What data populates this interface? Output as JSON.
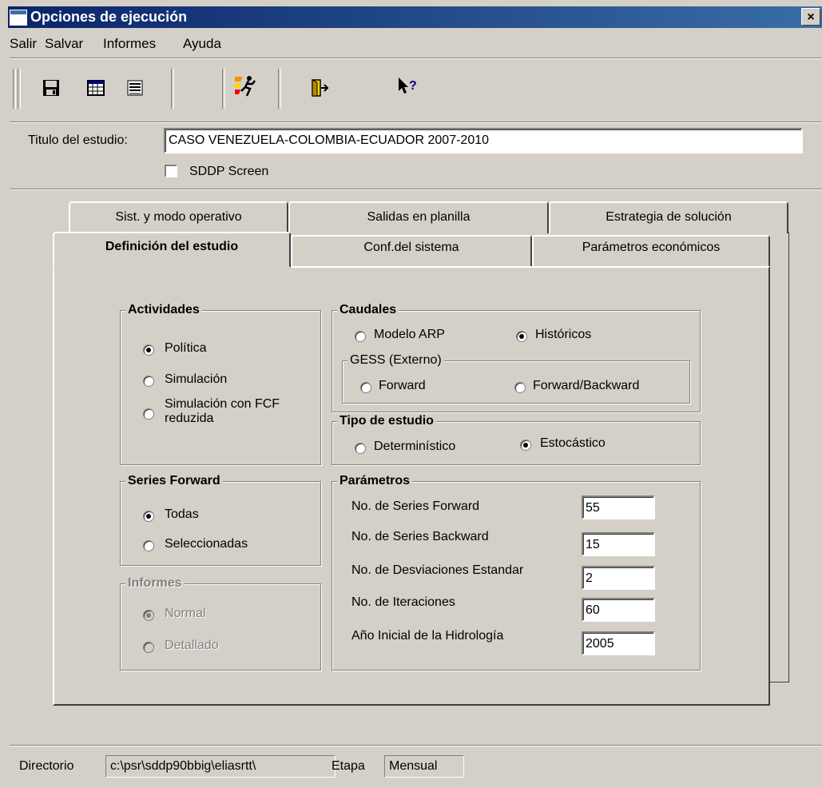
{
  "window": {
    "title": "Opciones de ejecución",
    "close": "×"
  },
  "menu": [
    "Salir",
    "Salvar",
    "Informes",
    "Ayuda"
  ],
  "toolbar": {
    "icons": [
      "save-icon",
      "table-icon",
      "list-icon",
      "run-icon",
      "exit-icon",
      "help-pointer-icon"
    ]
  },
  "study": {
    "title_label": "Titulo del estudio:",
    "title_value": "CASO VENEZUELA-COLOMBIA-ECUADOR 2007-2010",
    "sddp_screen_label": "SDDP Screen",
    "sddp_screen_checked": false
  },
  "tabs": {
    "row1": [
      "Sist. y modo operativo",
      "Salidas en planilla",
      "Estrategia de solución"
    ],
    "row2": [
      "Definición del estudio",
      "Conf.del sistema",
      "Parámetros económicos"
    ],
    "active": "Definición del estudio"
  },
  "actividades": {
    "title": "Actividades",
    "options": [
      "Política",
      "Simulación",
      "Simulación con FCF",
      "reduzida"
    ],
    "selected": "Política"
  },
  "caudales": {
    "title": "Caudales",
    "modelo": "Modelo ARP",
    "historicos": "Históricos",
    "selected": "Históricos",
    "gess_title": "GESS (Externo)",
    "forward": "Forward",
    "forward_backward": "Forward/Backward"
  },
  "tipo": {
    "title": "Tipo de estudio",
    "deterministico": "Determinístico",
    "estocastico": "Estocástico",
    "selected": "Estocástico"
  },
  "series": {
    "title": "Series Forward",
    "todas": "Todas",
    "seleccionadas": "Seleccionadas",
    "selected": "Todas"
  },
  "parametros": {
    "title": "Parámetros",
    "rows": [
      {
        "label": "No. de Series Forward",
        "value": "55"
      },
      {
        "label": "No. de Series Backward",
        "value": "15"
      },
      {
        "label": "No. de Desviaciones Estandar",
        "value": "2"
      },
      {
        "label": "No. de Iteraciones",
        "value": "60"
      },
      {
        "label": "Año Inicial de la Hidrología",
        "value": "2005"
      }
    ]
  },
  "informes": {
    "title": "Informes",
    "normal": "Normal",
    "detallado": "Detallado",
    "selected": "Normal",
    "disabled": true
  },
  "status": {
    "dir_label": "Directorio",
    "dir_value": "c:\\psr\\sddp90bbig\\eliasrtt\\",
    "etapa_label": "Etapa",
    "etapa_value": "Mensual"
  }
}
